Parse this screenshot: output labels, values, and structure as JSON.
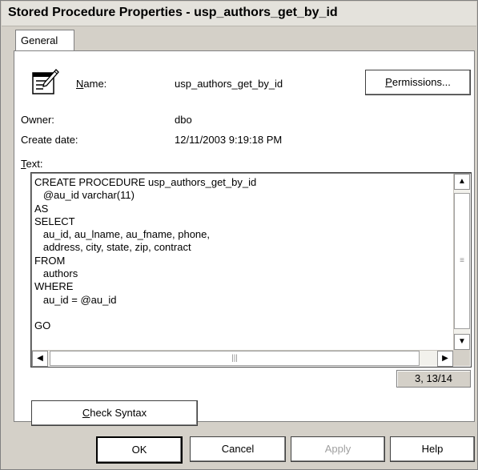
{
  "window": {
    "title": "Stored Procedure Properties - usp_authors_get_by_id"
  },
  "tabs": [
    {
      "label": "General",
      "selected": true
    }
  ],
  "icons": {
    "procedure": "stored-procedure-icon",
    "scroll_up": "scroll-up-arrow-icon",
    "scroll_down": "scroll-down-arrow-icon",
    "scroll_left": "scroll-left-arrow-icon",
    "scroll_right": "scroll-right-arrow-icon"
  },
  "properties": {
    "name_label": "Name:",
    "name_label_accel": "N",
    "name_label_rest": "ame:",
    "name_value": "usp_authors_get_by_id",
    "permissions_label": "Permissions...",
    "permissions_accel": "P",
    "permissions_rest": "ermissions...",
    "owner_label": "Owner:",
    "owner_value": "dbo",
    "create_date_label": "Create date:",
    "create_date_value": "12/11/2003 9:19:18 PM",
    "text_label": "Text:",
    "text_label_accel": "T",
    "text_label_rest": "ext:"
  },
  "editor": {
    "lines": [
      "CREATE PROCEDURE usp_authors_get_by_id",
      "   @au_id varchar(11)",
      "AS",
      "SELECT",
      "   au_id, au_lname, au_fname, phone,",
      "   address, city, state, zip, contract",
      "FROM",
      "   authors",
      "WHERE",
      "   au_id = @au_id",
      "",
      "GO"
    ],
    "cursor_position": "3, 13/14"
  },
  "buttons": {
    "check_syntax": "Check Syntax",
    "check_syntax_accel": "C",
    "check_syntax_rest": "heck Syntax",
    "ok": "OK",
    "cancel": "Cancel",
    "apply": "Apply",
    "help": "Help"
  },
  "colors": {
    "dialog_background": "#d4d0c8",
    "disabled_text": "#a0a0a0"
  }
}
